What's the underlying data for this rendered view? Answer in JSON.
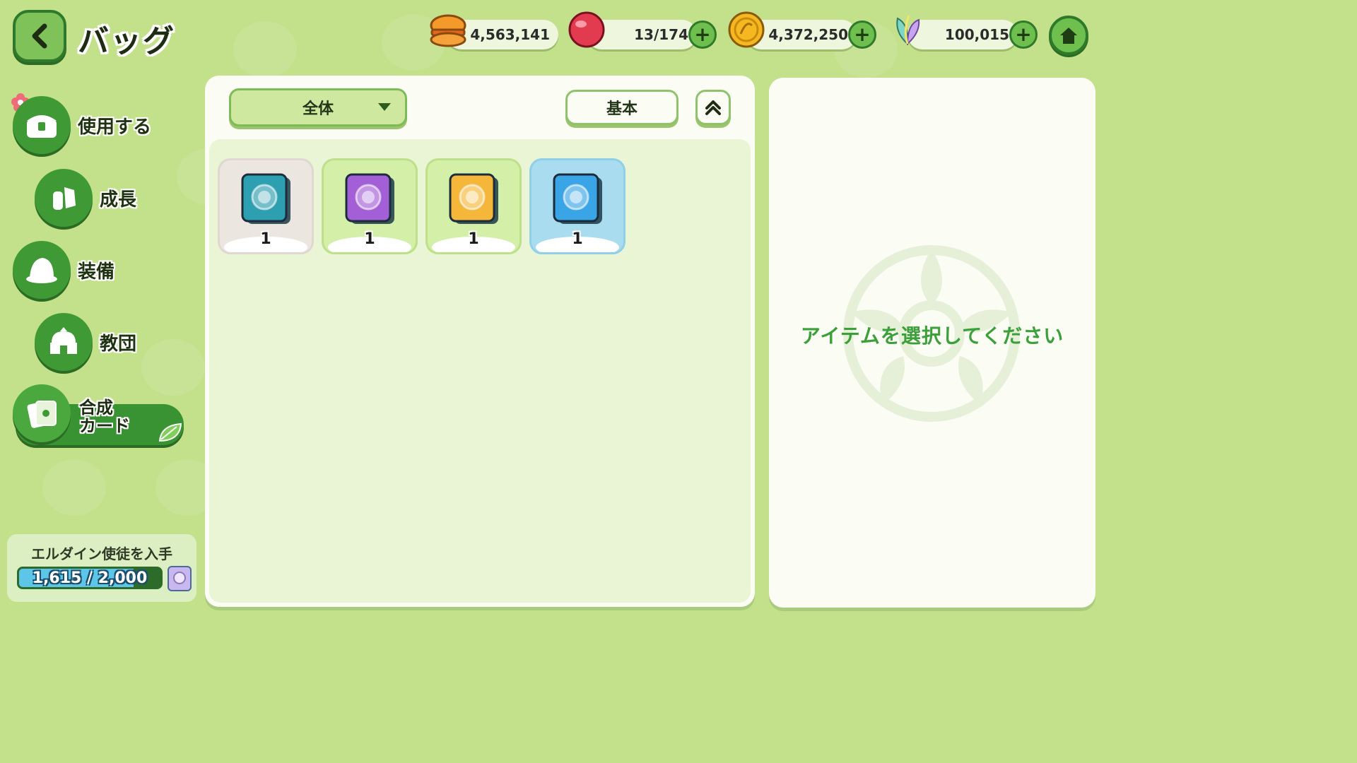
{
  "header": {
    "title": "バッグ",
    "currencies": [
      {
        "name": "burger-icon",
        "value": "4,563,141"
      },
      {
        "name": "ruby-icon",
        "value": "13/174"
      },
      {
        "name": "gold-coin-icon",
        "value": "4,372,250"
      },
      {
        "name": "crystal-leaf-icon",
        "value": "100,015"
      }
    ]
  },
  "sidebar": {
    "items": [
      {
        "label": "使用する",
        "icon": "treasure-box-icon"
      },
      {
        "label": "成長",
        "icon": "potion-crystal-icon"
      },
      {
        "label": "装備",
        "icon": "hat-icon"
      },
      {
        "label": "教団",
        "icon": "building-icon"
      },
      {
        "label_line1": "合成",
        "label_line2": "カード",
        "icon": "card-icon",
        "active": true
      }
    ],
    "progress": {
      "title": "エルダイン使徒を入手",
      "text": "1,615 / 2,000",
      "current": 1615,
      "max": 2000
    }
  },
  "main": {
    "filter_selected": "全体",
    "sort_label": "基本",
    "items": [
      {
        "name": "teal-card-pack",
        "count": "1",
        "color": "#2e9fb0",
        "bg": "#ece6e0"
      },
      {
        "name": "purple-card-pack",
        "count": "1",
        "color": "#a25fd6",
        "bg": "#d3efa8"
      },
      {
        "name": "yellow-card-pack",
        "count": "1",
        "color": "#f4b73a",
        "bg": "#d3efa8"
      },
      {
        "name": "blue-card-pack",
        "count": "1",
        "color": "#3aa5e6",
        "bg": "#a9dcef"
      }
    ]
  },
  "detail": {
    "prompt": "アイテムを選択してください"
  },
  "colors": {
    "background": "#c3e08b",
    "accent_green": "#3f9a36",
    "prompt_green": "#3ba03a",
    "progress_blue": "#5dc6e8"
  }
}
